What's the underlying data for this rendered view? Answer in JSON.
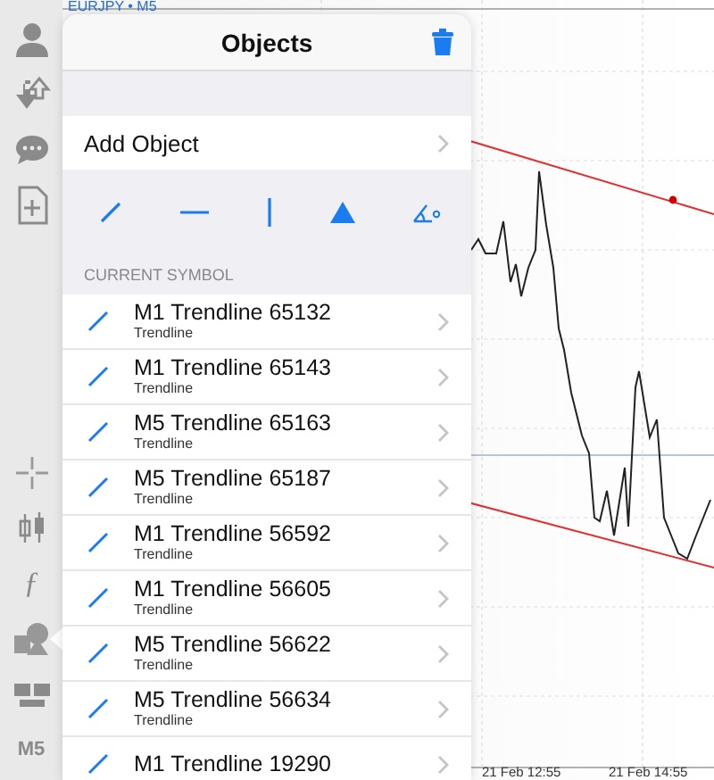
{
  "chart": {
    "symbol": "EURJPY • M5",
    "xlabels": [
      "21 Feb 12:55",
      "21 Feb 14:55"
    ]
  },
  "toolbar": {
    "top": [
      {
        "kind": "account",
        "selected": false
      },
      {
        "kind": "trade",
        "selected": false
      },
      {
        "kind": "chat",
        "selected": false
      },
      {
        "kind": "new-doc",
        "selected": false
      }
    ],
    "bottom": [
      {
        "kind": "crosshair",
        "selected": false
      },
      {
        "kind": "candles",
        "selected": false
      },
      {
        "kind": "indicators",
        "label": "ƒ",
        "selected": false
      },
      {
        "kind": "objects",
        "selected": true
      },
      {
        "kind": "windows",
        "selected": false
      },
      {
        "kind": "timeframe",
        "label": "M5",
        "selected": false
      }
    ]
  },
  "panel": {
    "title": "Objects",
    "add_label": "Add Object",
    "tools": [
      {
        "kind": "trendline"
      },
      {
        "kind": "horizontal"
      },
      {
        "kind": "vertical"
      },
      {
        "kind": "triangle"
      },
      {
        "kind": "angle"
      }
    ],
    "section": "CURRENT SYMBOL",
    "items": [
      {
        "title": "M1 Trendline 65132",
        "subtitle": "Trendline"
      },
      {
        "title": "M1 Trendline 65143",
        "subtitle": "Trendline"
      },
      {
        "title": "M5 Trendline 65163",
        "subtitle": "Trendline"
      },
      {
        "title": "M5 Trendline 65187",
        "subtitle": "Trendline"
      },
      {
        "title": "M1 Trendline 56592",
        "subtitle": "Trendline"
      },
      {
        "title": "M1 Trendline 56605",
        "subtitle": "Trendline"
      },
      {
        "title": "M5 Trendline 56622",
        "subtitle": "Trendline"
      },
      {
        "title": "M5 Trendline 56634",
        "subtitle": "Trendline"
      },
      {
        "title": "M1 Trendline 19290"
      }
    ]
  }
}
